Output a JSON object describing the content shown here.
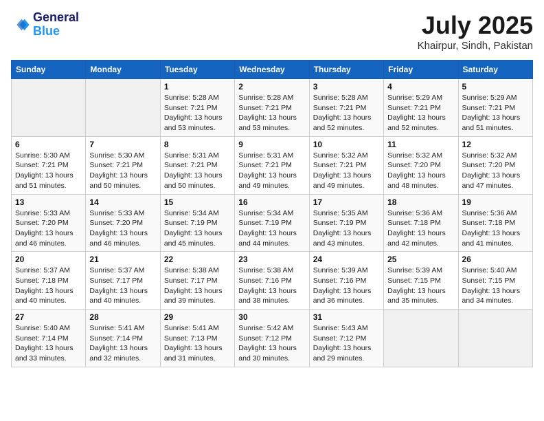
{
  "header": {
    "logo_line1": "General",
    "logo_line2": "Blue",
    "month": "July 2025",
    "location": "Khairpur, Sindh, Pakistan"
  },
  "weekdays": [
    "Sunday",
    "Monday",
    "Tuesday",
    "Wednesday",
    "Thursday",
    "Friday",
    "Saturday"
  ],
  "weeks": [
    [
      {
        "day": "",
        "info": ""
      },
      {
        "day": "",
        "info": ""
      },
      {
        "day": "1",
        "info": "Sunrise: 5:28 AM\nSunset: 7:21 PM\nDaylight: 13 hours and 53 minutes."
      },
      {
        "day": "2",
        "info": "Sunrise: 5:28 AM\nSunset: 7:21 PM\nDaylight: 13 hours and 53 minutes."
      },
      {
        "day": "3",
        "info": "Sunrise: 5:28 AM\nSunset: 7:21 PM\nDaylight: 13 hours and 52 minutes."
      },
      {
        "day": "4",
        "info": "Sunrise: 5:29 AM\nSunset: 7:21 PM\nDaylight: 13 hours and 52 minutes."
      },
      {
        "day": "5",
        "info": "Sunrise: 5:29 AM\nSunset: 7:21 PM\nDaylight: 13 hours and 51 minutes."
      }
    ],
    [
      {
        "day": "6",
        "info": "Sunrise: 5:30 AM\nSunset: 7:21 PM\nDaylight: 13 hours and 51 minutes."
      },
      {
        "day": "7",
        "info": "Sunrise: 5:30 AM\nSunset: 7:21 PM\nDaylight: 13 hours and 50 minutes."
      },
      {
        "day": "8",
        "info": "Sunrise: 5:31 AM\nSunset: 7:21 PM\nDaylight: 13 hours and 50 minutes."
      },
      {
        "day": "9",
        "info": "Sunrise: 5:31 AM\nSunset: 7:21 PM\nDaylight: 13 hours and 49 minutes."
      },
      {
        "day": "10",
        "info": "Sunrise: 5:32 AM\nSunset: 7:21 PM\nDaylight: 13 hours and 49 minutes."
      },
      {
        "day": "11",
        "info": "Sunrise: 5:32 AM\nSunset: 7:20 PM\nDaylight: 13 hours and 48 minutes."
      },
      {
        "day": "12",
        "info": "Sunrise: 5:32 AM\nSunset: 7:20 PM\nDaylight: 13 hours and 47 minutes."
      }
    ],
    [
      {
        "day": "13",
        "info": "Sunrise: 5:33 AM\nSunset: 7:20 PM\nDaylight: 13 hours and 46 minutes."
      },
      {
        "day": "14",
        "info": "Sunrise: 5:33 AM\nSunset: 7:20 PM\nDaylight: 13 hours and 46 minutes."
      },
      {
        "day": "15",
        "info": "Sunrise: 5:34 AM\nSunset: 7:19 PM\nDaylight: 13 hours and 45 minutes."
      },
      {
        "day": "16",
        "info": "Sunrise: 5:34 AM\nSunset: 7:19 PM\nDaylight: 13 hours and 44 minutes."
      },
      {
        "day": "17",
        "info": "Sunrise: 5:35 AM\nSunset: 7:19 PM\nDaylight: 13 hours and 43 minutes."
      },
      {
        "day": "18",
        "info": "Sunrise: 5:36 AM\nSunset: 7:18 PM\nDaylight: 13 hours and 42 minutes."
      },
      {
        "day": "19",
        "info": "Sunrise: 5:36 AM\nSunset: 7:18 PM\nDaylight: 13 hours and 41 minutes."
      }
    ],
    [
      {
        "day": "20",
        "info": "Sunrise: 5:37 AM\nSunset: 7:18 PM\nDaylight: 13 hours and 40 minutes."
      },
      {
        "day": "21",
        "info": "Sunrise: 5:37 AM\nSunset: 7:17 PM\nDaylight: 13 hours and 40 minutes."
      },
      {
        "day": "22",
        "info": "Sunrise: 5:38 AM\nSunset: 7:17 PM\nDaylight: 13 hours and 39 minutes."
      },
      {
        "day": "23",
        "info": "Sunrise: 5:38 AM\nSunset: 7:16 PM\nDaylight: 13 hours and 38 minutes."
      },
      {
        "day": "24",
        "info": "Sunrise: 5:39 AM\nSunset: 7:16 PM\nDaylight: 13 hours and 36 minutes."
      },
      {
        "day": "25",
        "info": "Sunrise: 5:39 AM\nSunset: 7:15 PM\nDaylight: 13 hours and 35 minutes."
      },
      {
        "day": "26",
        "info": "Sunrise: 5:40 AM\nSunset: 7:15 PM\nDaylight: 13 hours and 34 minutes."
      }
    ],
    [
      {
        "day": "27",
        "info": "Sunrise: 5:40 AM\nSunset: 7:14 PM\nDaylight: 13 hours and 33 minutes."
      },
      {
        "day": "28",
        "info": "Sunrise: 5:41 AM\nSunset: 7:14 PM\nDaylight: 13 hours and 32 minutes."
      },
      {
        "day": "29",
        "info": "Sunrise: 5:41 AM\nSunset: 7:13 PM\nDaylight: 13 hours and 31 minutes."
      },
      {
        "day": "30",
        "info": "Sunrise: 5:42 AM\nSunset: 7:12 PM\nDaylight: 13 hours and 30 minutes."
      },
      {
        "day": "31",
        "info": "Sunrise: 5:43 AM\nSunset: 7:12 PM\nDaylight: 13 hours and 29 minutes."
      },
      {
        "day": "",
        "info": ""
      },
      {
        "day": "",
        "info": ""
      }
    ]
  ]
}
